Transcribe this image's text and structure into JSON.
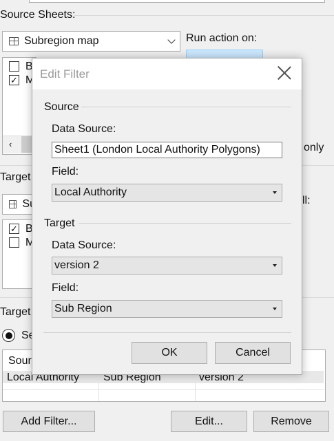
{
  "background": {
    "source_sheets_label": "Source Sheets:",
    "source_sheet_selected": "Subregion map",
    "run_action_label": "Run action on:",
    "source_items": [
      {
        "label": "B",
        "checked": false
      },
      {
        "label": "M",
        "checked": true
      }
    ],
    "run_action_right_text": "only",
    "target_label": "Target",
    "target_sheet_selected": "Su",
    "target_right_text": "ll:",
    "target_items": [
      {
        "label": "B",
        "checked": true
      },
      {
        "label": "M",
        "checked": false
      }
    ],
    "target_filters_label": "Target",
    "radio_label": "Se",
    "table_header": "Sour",
    "table_row": {
      "c1": "Local Authority",
      "c2": "Sub Region",
      "c3": "version 2"
    },
    "add_filter_button": "Add Filter...",
    "edit_button": "Edit...",
    "remove_button": "Remove"
  },
  "dialog": {
    "title": "Edit Filter",
    "source": {
      "group_label": "Source",
      "data_source_label": "Data Source:",
      "data_source_value": "Sheet1 (London Local Authority Polygons)",
      "field_label": "Field:",
      "field_value": "Local Authority"
    },
    "target": {
      "group_label": "Target",
      "data_source_label": "Data Source:",
      "data_source_value": "version 2",
      "field_label": "Field:",
      "field_value": "Sub Region"
    },
    "ok_button": "OK",
    "cancel_button": "Cancel"
  },
  "colors": {
    "window_bg": "#f0f0f0",
    "button_bg": "#e1e1e1",
    "dropdown_bg": "#e5e5e5",
    "title_text": "#9a9a9a",
    "selection_blue": "#cce8ff"
  }
}
